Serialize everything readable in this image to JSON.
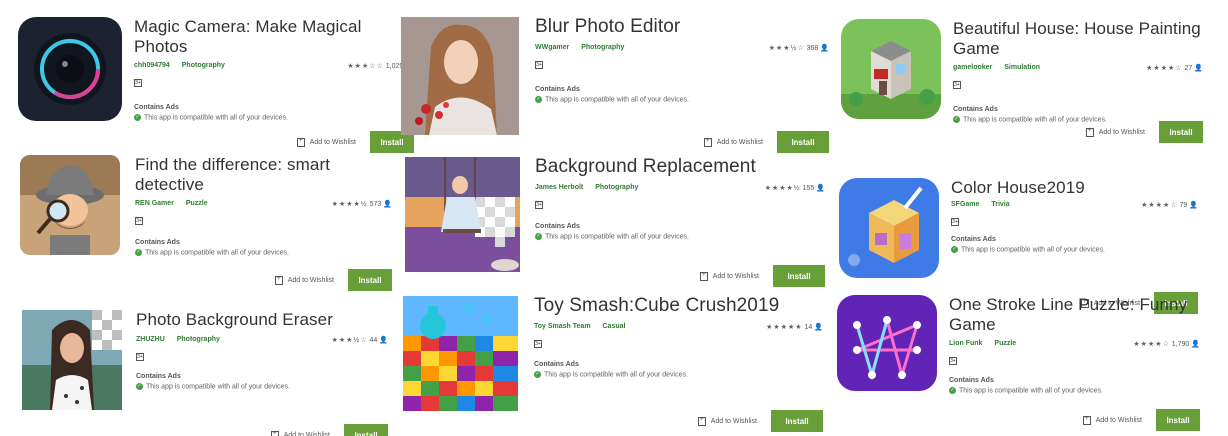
{
  "common": {
    "contains_ads": "Contains Ads",
    "compatible": "This app is compatible with all of your devices.",
    "wishlist": "Add to Wishlist",
    "install": "Install",
    "rating_badge": "3+",
    "accent_color": "#689f38",
    "developer_color": "#2e7d32"
  },
  "apps": [
    {
      "title": "Magic Camera: Make Magical Photos",
      "developer": "chh094794",
      "category": "Photography",
      "stars": "★★★☆☆",
      "star_value": 3,
      "reviews": "1,029"
    },
    {
      "title": "Blur Photo Editor",
      "developer": "WWgamer",
      "category": "Photography",
      "stars": "★★★½☆",
      "star_value": 3.5,
      "reviews": "368"
    },
    {
      "title": "Beautiful House: House Painting Game",
      "developer": "gamelooker",
      "category": "Simulation",
      "stars": "★★★★☆",
      "star_value": 4,
      "reviews": "27"
    },
    {
      "title": "Find the difference: smart detective",
      "developer": "REN Gamer",
      "category": "Puzzle",
      "stars": "★★★★½",
      "star_value": 4.5,
      "reviews": "573"
    },
    {
      "title": "Background Replacement",
      "developer": "James Herbolt",
      "category": "Photography",
      "stars": "★★★★½",
      "star_value": 4.5,
      "reviews": "155"
    },
    {
      "title": "Color House2019",
      "developer": "SFGame",
      "category": "Trivia",
      "stars": "★★★★☆",
      "star_value": 4,
      "reviews": "79"
    },
    {
      "title": "Photo Background Eraser",
      "developer": "ZHUZHU",
      "category": "Photography",
      "stars": "★★★½☆",
      "star_value": 3.5,
      "reviews": "44"
    },
    {
      "title": "Toy Smash:Cube Crush2019",
      "developer": "Toy Smash Team",
      "category": "Casual",
      "stars": "★★★★★",
      "star_value": 5,
      "reviews": "14"
    },
    {
      "title": "One Stroke Line Puzzle: Funny Game",
      "developer": "Lion Funk",
      "category": "Puzzle",
      "stars": "★★★★☆",
      "star_value": 4,
      "reviews": "1,790"
    }
  ]
}
